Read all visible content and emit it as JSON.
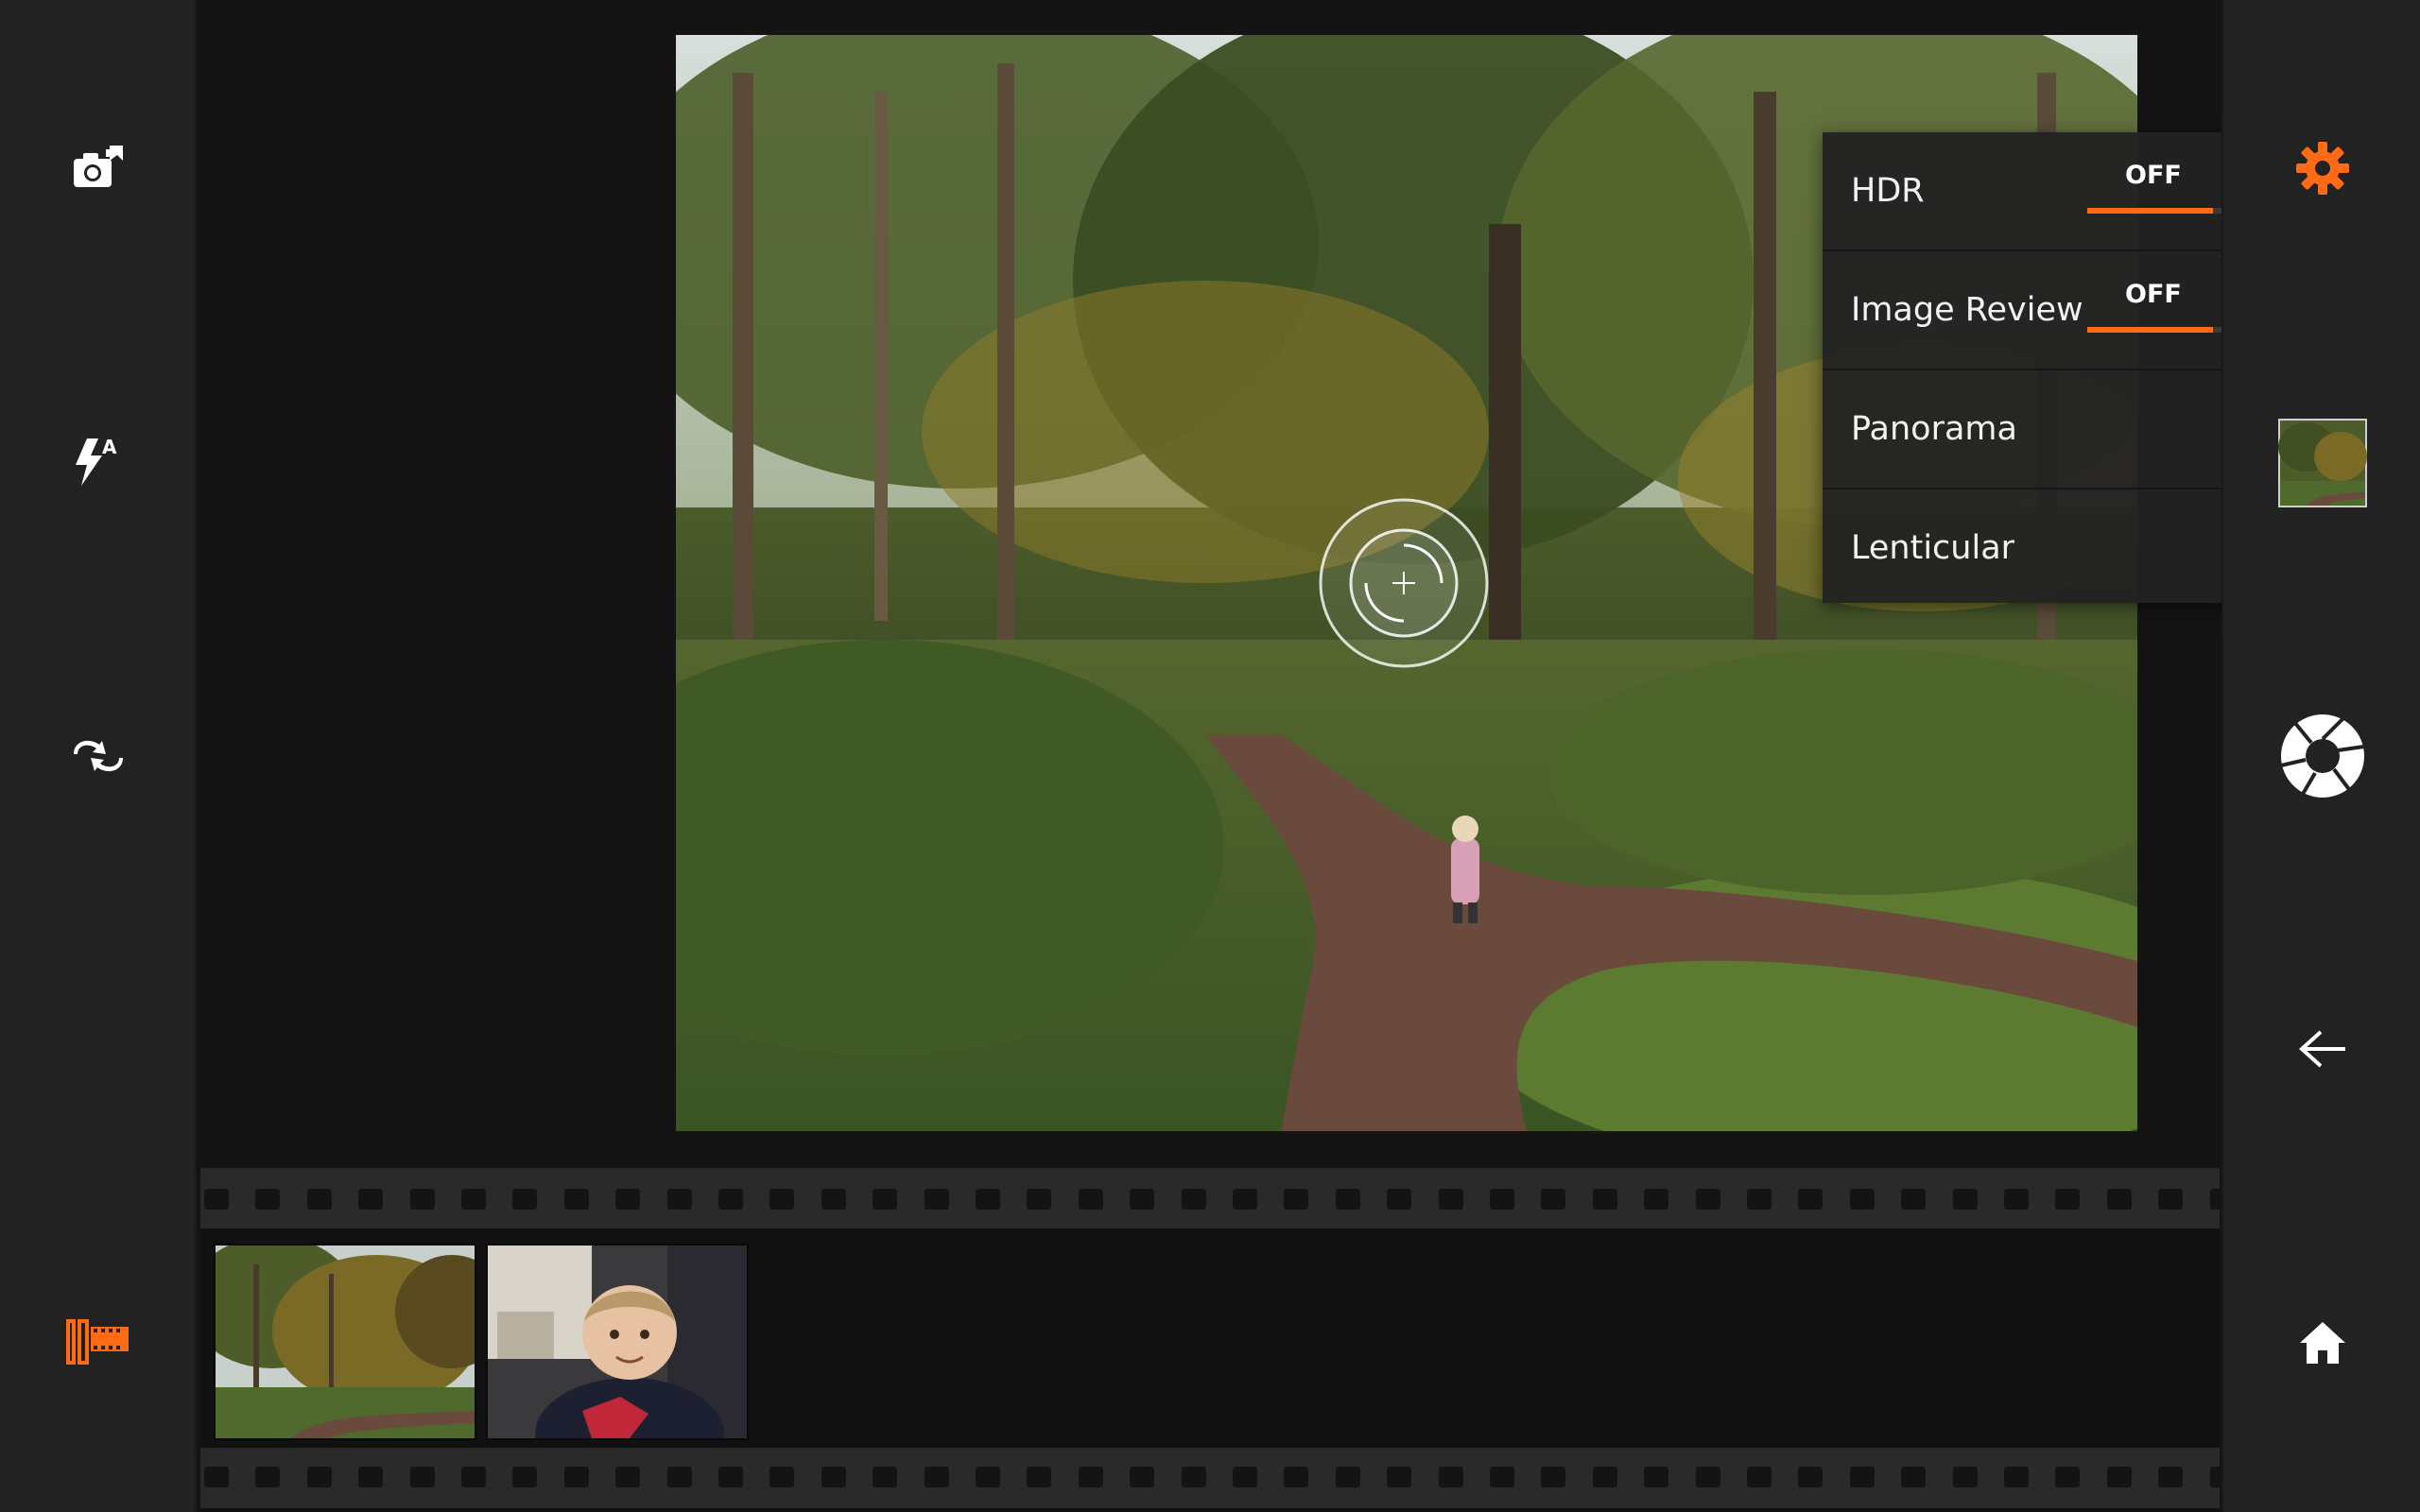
{
  "left_rail": {
    "buttons": [
      {
        "name": "camera-video-switch",
        "icon": "camera-switch-icon"
      },
      {
        "name": "flash-auto",
        "icon": "flash-auto-icon"
      },
      {
        "name": "swap-camera",
        "icon": "swap-arrows-icon"
      },
      {
        "name": "filmstrip-toggle",
        "icon": "filmstrip-icon",
        "color": "#ff6a14"
      }
    ]
  },
  "right_rail": {
    "buttons": [
      {
        "name": "settings",
        "icon": "gear-icon",
        "color": "#ff6a14"
      },
      {
        "name": "last-photo-thumbnail",
        "icon": "photo-thumbnail"
      },
      {
        "name": "shutter",
        "icon": "shutter-icon"
      },
      {
        "name": "back",
        "icon": "back-arrow-icon"
      },
      {
        "name": "home",
        "icon": "home-icon"
      }
    ]
  },
  "settings": {
    "hdr": {
      "label": "HDR",
      "state": "OFF",
      "fill": 0.5
    },
    "image_review": {
      "label": "Image Review",
      "state": "OFF",
      "fill": 0.5
    },
    "panorama": {
      "label": "Panorama"
    },
    "lenticular": {
      "label": "Lenticular"
    }
  },
  "filmstrip": {
    "thumbnails": [
      {
        "name": "forest-path-photo"
      },
      {
        "name": "child-portrait-photo"
      }
    ]
  },
  "colors": {
    "accent": "#ff6a14",
    "rail_bg": "#222222",
    "main_bg": "#141414"
  }
}
